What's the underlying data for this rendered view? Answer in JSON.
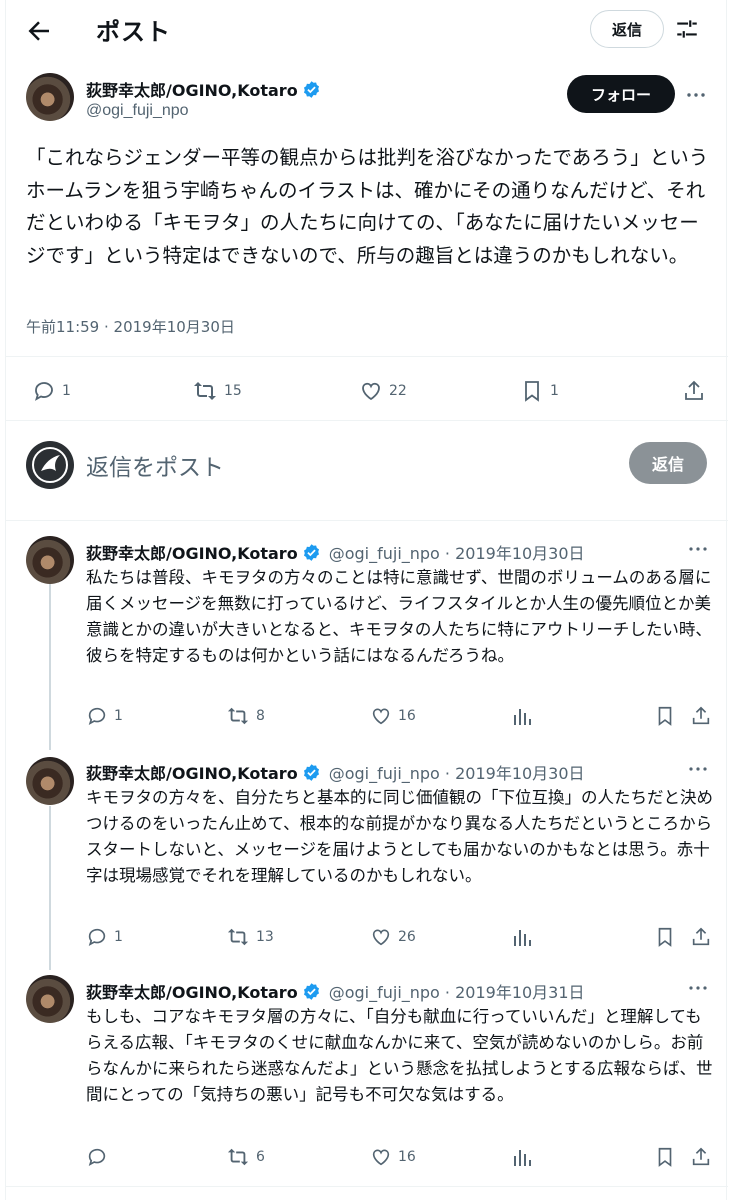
{
  "header": {
    "title": "ポスト",
    "reply_button": "返信"
  },
  "main_post": {
    "author_name": "荻野幸太郎/OGINO,Kotaro",
    "handle": "@ogi_fuji_npo",
    "follow_label": "フォロー",
    "text": "「これならジェンダー平等の観点からは批判を浴びなかったであろう」というホームランを狙う宇崎ちゃんのイラストは、確かにその通りなんだけど、それだといわゆる「キモヲタ」の人たちに向けての、「あなたに届けたいメッセージです」という特定はできないので、所与の趣旨とは違うのかもしれない。",
    "timestamp": "午前11:59 · 2019年10月30日",
    "stats": {
      "replies": "1",
      "reposts": "15",
      "likes": "22",
      "bookmarks": "1"
    }
  },
  "composer": {
    "placeholder": "返信をポスト",
    "button": "返信"
  },
  "replies": [
    {
      "author_name": "荻野幸太郎/OGINO,Kotaro",
      "meta": "@ogi_fuji_npo · 2019年10月30日",
      "text": "私たちは普段、キモヲタの方々のことは特に意識せず、世間のボリュームのある層に届くメッセージを無数に打っているけど、ライフスタイルとか人生の優先順位とか美意識とかの違いが大きいとなると、キモヲタの人たちに特にアウトリーチしたい時、彼らを特定するものは何かという話にはなるんだろうね。",
      "stats": {
        "replies": "1",
        "reposts": "8",
        "likes": "16"
      }
    },
    {
      "author_name": "荻野幸太郎/OGINO,Kotaro",
      "meta": "@ogi_fuji_npo · 2019年10月30日",
      "text": "キモヲタの方々を、自分たちと基本的に同じ価値観の「下位互換」の人たちだと決めつけるのをいったん止めて、根本的な前提がかなり異なる人たちだというところからスタートしないと、メッセージを届けようとしても届かないのかもなとは思う。赤十字は現場感覚でそれを理解しているのかもしれない。",
      "stats": {
        "replies": "1",
        "reposts": "13",
        "likes": "26"
      }
    },
    {
      "author_name": "荻野幸太郎/OGINO,Kotaro",
      "meta": "@ogi_fuji_npo · 2019年10月31日",
      "text": "もしも、コアなキモヲタ層の方々に、「自分も献血に行っていいんだ」と理解してもらえる広報、「キモヲタのくせに献血なんかに来て、空気が読めないのかしら。お前らなんかに来られたら迷惑なんだよ」という懸念を払拭しようとする広報ならば、世間にとっての「気持ちの悪い」記号も不可欠な気はする。",
      "stats": {
        "replies": "",
        "reposts": "6",
        "likes": "16"
      }
    }
  ],
  "colors": {
    "text": "#0f1419",
    "secondary": "#536471",
    "verified": "#1d9bf0",
    "border": "#eff3f4"
  }
}
